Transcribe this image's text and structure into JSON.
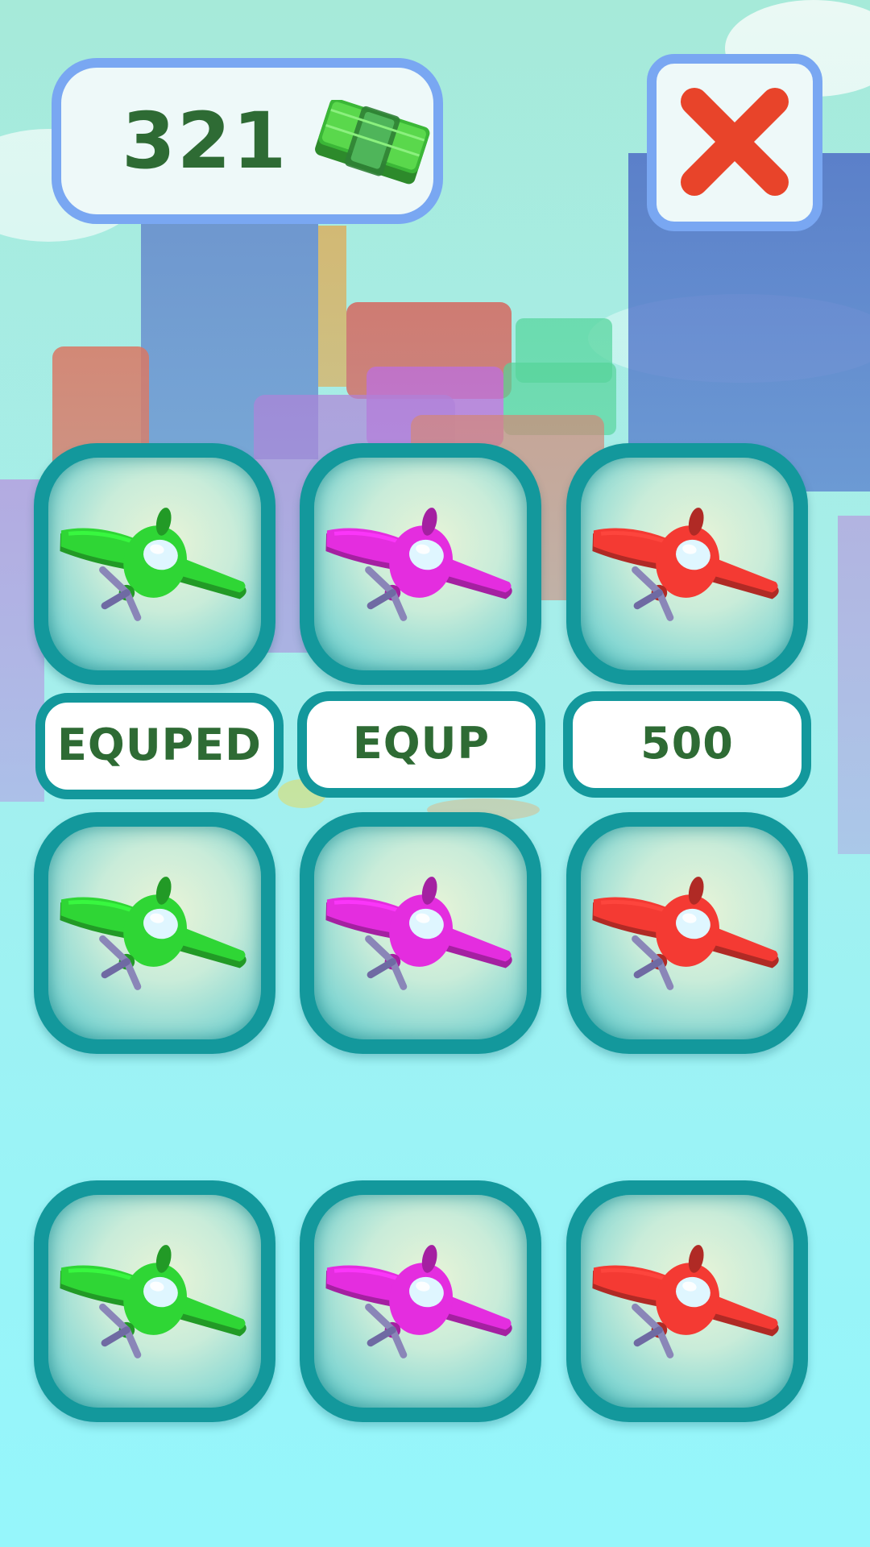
{
  "currency": {
    "amount": "321",
    "icon": "cash-stack-icon"
  },
  "close": {
    "icon": "close-x-icon"
  },
  "colors": {
    "panel_border": "#79a7f2",
    "panel_fill": "#eef9f9",
    "text_green": "#2e6b34",
    "close_red": "#e8442a",
    "slot_teal": "#13989c"
  },
  "shop": {
    "rows": [
      {
        "items": [
          {
            "color": "green",
            "body": "#2fd635",
            "status": "EQUPED"
          },
          {
            "color": "magenta",
            "body": "#e42ddf",
            "status": "EQUP"
          },
          {
            "color": "red",
            "body": "#f43a33",
            "status": "500"
          }
        ]
      },
      {
        "items": [
          {
            "color": "green",
            "body": "#2fd635"
          },
          {
            "color": "magenta",
            "body": "#e42ddf"
          },
          {
            "color": "red",
            "body": "#f43a33"
          }
        ]
      },
      {
        "items": [
          {
            "color": "green",
            "body": "#2fd635"
          },
          {
            "color": "magenta",
            "body": "#e42ddf"
          },
          {
            "color": "red",
            "body": "#f43a33"
          }
        ]
      }
    ]
  }
}
